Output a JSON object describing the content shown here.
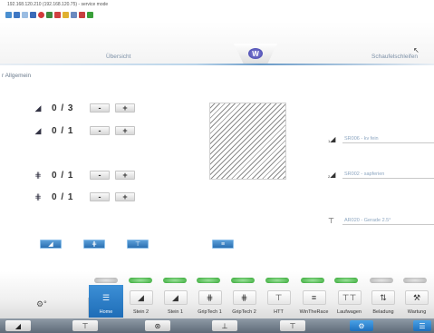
{
  "window": {
    "title": "192.168.120.210 (192.168.120.75) - service mode"
  },
  "toolbar": {
    "icons": [
      "refresh-icon",
      "home-icon",
      "doc-icon",
      "save-icon",
      "stop-icon",
      "chart-icon",
      "flag-icon",
      "folder-icon",
      "tools-icon",
      "settings-icon",
      "grid-icon"
    ]
  },
  "header": {
    "tab_left": "Übersicht",
    "tab_right": "Schaufelschleifen",
    "logo": "W"
  },
  "section": {
    "label": "r Allgemein"
  },
  "rows": [
    {
      "count": "0 / 3",
      "minus": "-",
      "plus": "+"
    },
    {
      "count": "0 / 1",
      "minus": "-",
      "plus": "+"
    },
    {
      "count": "0 / 1",
      "minus": "-",
      "plus": "+"
    },
    {
      "count": "0 / 1",
      "minus": "-",
      "plus": "+"
    }
  ],
  "selectors": [
    {
      "index": "1",
      "value": "SR006 - kv fein"
    },
    {
      "index": "2",
      "value": "SR002 - sapferien"
    },
    {
      "index": "",
      "value": "AR020 - Gerade 2.5°"
    }
  ],
  "modes": [
    {
      "label": "Home",
      "status": "none",
      "active": true
    },
    {
      "label": "Stein 2",
      "status": "green",
      "active": false
    },
    {
      "label": "Stein 1",
      "status": "green",
      "active": false
    },
    {
      "label": "GripTech 1",
      "status": "green",
      "active": false
    },
    {
      "label": "GripTech 2",
      "status": "green",
      "active": false
    },
    {
      "label": "HTT",
      "status": "green",
      "active": false
    },
    {
      "label": "WinTheRace",
      "status": "green",
      "active": false
    },
    {
      "label": "Laufwagen",
      "status": "green",
      "active": false
    },
    {
      "label": "Beladung",
      "status": "grey",
      "active": false
    },
    {
      "label": "Wartung",
      "status": "grey",
      "active": false
    }
  ],
  "colors": {
    "accent": "#2a7cc7",
    "status_green": "#34a834",
    "status_grey": "#b0b0b0",
    "taskbar": "#6b7683"
  }
}
